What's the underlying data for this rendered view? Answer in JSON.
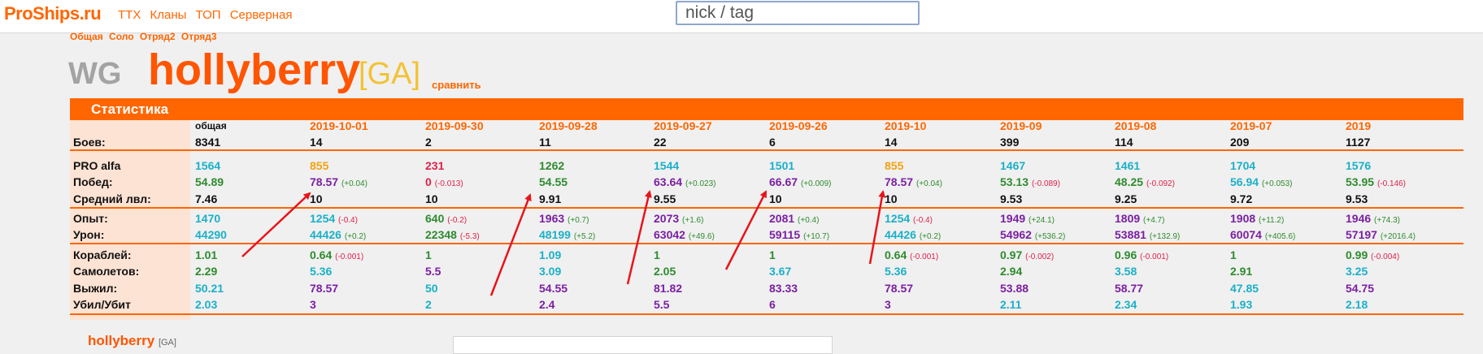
{
  "header": {
    "logo": "ProShips.ru",
    "nav": [
      "ТТХ",
      "Кланы",
      "ТОП",
      "Серверная"
    ],
    "search_placeholder": "nick / tag"
  },
  "view_tabs": [
    "Общая",
    "Соло",
    "Отряд2",
    "Отряд3"
  ],
  "player": {
    "clan_logo": "WG",
    "name": "hollyberry",
    "tag": "[GA]",
    "compare": "сравнить"
  },
  "stats": {
    "title": "Статистика",
    "columns": [
      "общая",
      "2019-10-01",
      "2019-09-30",
      "2019-09-28",
      "2019-09-27",
      "2019-09-26",
      "2019-10",
      "2019-09",
      "2019-08",
      "2019-07",
      "2019"
    ],
    "rows": [
      {
        "label": "Боев:",
        "cells": [
          {
            "v": "8341",
            "c": "#111111"
          },
          {
            "v": "14",
            "c": "#111111"
          },
          {
            "v": "2",
            "c": "#111111"
          },
          {
            "v": "11",
            "c": "#111111"
          },
          {
            "v": "22",
            "c": "#111111"
          },
          {
            "v": "6",
            "c": "#111111"
          },
          {
            "v": "14",
            "c": "#111111"
          },
          {
            "v": "399",
            "c": "#111111"
          },
          {
            "v": "114",
            "c": "#111111"
          },
          {
            "v": "209",
            "c": "#111111"
          },
          {
            "v": "1127",
            "c": "#111111"
          }
        ]
      },
      {
        "label": "PRO alfa",
        "cells": [
          {
            "v": "1564",
            "c": "#1ab0c8"
          },
          {
            "v": "855",
            "c": "#f2a20f"
          },
          {
            "v": "231",
            "c": "#e0204a"
          },
          {
            "v": "1262",
            "c": "#2e8b2e"
          },
          {
            "v": "1544",
            "c": "#1ab0c8"
          },
          {
            "v": "1501",
            "c": "#1ab0c8"
          },
          {
            "v": "855",
            "c": "#f2a20f"
          },
          {
            "v": "1467",
            "c": "#1ab0c8"
          },
          {
            "v": "1461",
            "c": "#1ab0c8"
          },
          {
            "v": "1704",
            "c": "#1ab0c8"
          },
          {
            "v": "1576",
            "c": "#1ab0c8"
          }
        ]
      },
      {
        "label": "Побед:",
        "cells": [
          {
            "v": "54.89",
            "c": "#2e8b2e"
          },
          {
            "v": "78.57",
            "c": "#7b1fa2",
            "d": "(+0.04)",
            "dc": "#2e8b2e"
          },
          {
            "v": "0",
            "c": "#e0204a",
            "d": "(-0.013)",
            "dc": "#e0204a"
          },
          {
            "v": "54.55",
            "c": "#2e8b2e"
          },
          {
            "v": "63.64",
            "c": "#7b1fa2",
            "d": "(+0.023)",
            "dc": "#2e8b2e"
          },
          {
            "v": "66.67",
            "c": "#7b1fa2",
            "d": "(+0.009)",
            "dc": "#2e8b2e"
          },
          {
            "v": "78.57",
            "c": "#7b1fa2",
            "d": "(+0.04)",
            "dc": "#2e8b2e"
          },
          {
            "v": "53.13",
            "c": "#2e8b2e",
            "d": "(-0.089)",
            "dc": "#e0204a"
          },
          {
            "v": "48.25",
            "c": "#2e8b2e",
            "d": "(-0.092)",
            "dc": "#e0204a"
          },
          {
            "v": "56.94",
            "c": "#1ab0c8",
            "d": "(+0.053)",
            "dc": "#2e8b2e"
          },
          {
            "v": "53.95",
            "c": "#2e8b2e",
            "d": "(-0.146)",
            "dc": "#e0204a"
          }
        ]
      },
      {
        "label": "Средний лвл:",
        "cells": [
          {
            "v": "7.46",
            "c": "#111111"
          },
          {
            "v": "10",
            "c": "#111111"
          },
          {
            "v": "10",
            "c": "#111111"
          },
          {
            "v": "9.91",
            "c": "#111111"
          },
          {
            "v": "9.55",
            "c": "#111111"
          },
          {
            "v": "10",
            "c": "#111111"
          },
          {
            "v": "10",
            "c": "#111111"
          },
          {
            "v": "9.53",
            "c": "#111111"
          },
          {
            "v": "9.25",
            "c": "#111111"
          },
          {
            "v": "9.72",
            "c": "#111111"
          },
          {
            "v": "9.53",
            "c": "#111111"
          }
        ]
      },
      {
        "label": "Опыт:",
        "cells": [
          {
            "v": "1470",
            "c": "#1ab0c8"
          },
          {
            "v": "1254",
            "c": "#1ab0c8",
            "d": "(-0.4)",
            "dc": "#e0204a"
          },
          {
            "v": "640",
            "c": "#2e8b2e",
            "d": "(-0.2)",
            "dc": "#e0204a"
          },
          {
            "v": "1963",
            "c": "#7b1fa2",
            "d": "(+0.7)",
            "dc": "#2e8b2e"
          },
          {
            "v": "2073",
            "c": "#7b1fa2",
            "d": "(+1.6)",
            "dc": "#2e8b2e"
          },
          {
            "v": "2081",
            "c": "#7b1fa2",
            "d": "(+0.4)",
            "dc": "#2e8b2e"
          },
          {
            "v": "1254",
            "c": "#1ab0c8",
            "d": "(-0.4)",
            "dc": "#e0204a"
          },
          {
            "v": "1949",
            "c": "#7b1fa2",
            "d": "(+24.1)",
            "dc": "#2e8b2e"
          },
          {
            "v": "1809",
            "c": "#7b1fa2",
            "d": "(+4.7)",
            "dc": "#2e8b2e"
          },
          {
            "v": "1908",
            "c": "#7b1fa2",
            "d": "(+11.2)",
            "dc": "#2e8b2e"
          },
          {
            "v": "1946",
            "c": "#7b1fa2",
            "d": "(+74.3)",
            "dc": "#2e8b2e"
          }
        ]
      },
      {
        "label": "Урон:",
        "cells": [
          {
            "v": "44290",
            "c": "#1ab0c8"
          },
          {
            "v": "44426",
            "c": "#1ab0c8",
            "d": "(+0.2)",
            "dc": "#2e8b2e"
          },
          {
            "v": "22348",
            "c": "#2e8b2e",
            "d": "(-5.3)",
            "dc": "#e0204a"
          },
          {
            "v": "48199",
            "c": "#1ab0c8",
            "d": "(+5.2)",
            "dc": "#2e8b2e"
          },
          {
            "v": "63042",
            "c": "#7b1fa2",
            "d": "(+49.6)",
            "dc": "#2e8b2e"
          },
          {
            "v": "59115",
            "c": "#7b1fa2",
            "d": "(+10.7)",
            "dc": "#2e8b2e"
          },
          {
            "v": "44426",
            "c": "#1ab0c8",
            "d": "(+0.2)",
            "dc": "#2e8b2e"
          },
          {
            "v": "54962",
            "c": "#7b1fa2",
            "d": "(+536.2)",
            "dc": "#2e8b2e"
          },
          {
            "v": "53881",
            "c": "#7b1fa2",
            "d": "(+132.9)",
            "dc": "#2e8b2e"
          },
          {
            "v": "60074",
            "c": "#7b1fa2",
            "d": "(+405.6)",
            "dc": "#2e8b2e"
          },
          {
            "v": "57197",
            "c": "#7b1fa2",
            "d": "(+2016.4)",
            "dc": "#2e8b2e"
          }
        ]
      },
      {
        "label": "Кораблей:",
        "cells": [
          {
            "v": "1.01",
            "c": "#2e8b2e"
          },
          {
            "v": "0.64",
            "c": "#2e8b2e",
            "d": "(-0.001)",
            "dc": "#e0204a"
          },
          {
            "v": "1",
            "c": "#2e8b2e"
          },
          {
            "v": "1.09",
            "c": "#1ab0c8"
          },
          {
            "v": "1",
            "c": "#2e8b2e"
          },
          {
            "v": "1",
            "c": "#2e8b2e"
          },
          {
            "v": "0.64",
            "c": "#2e8b2e",
            "d": "(-0.001)",
            "dc": "#e0204a"
          },
          {
            "v": "0.97",
            "c": "#2e8b2e",
            "d": "(-0.002)",
            "dc": "#e0204a"
          },
          {
            "v": "0.96",
            "c": "#2e8b2e",
            "d": "(-0.001)",
            "dc": "#e0204a"
          },
          {
            "v": "1",
            "c": "#2e8b2e"
          },
          {
            "v": "0.99",
            "c": "#2e8b2e",
            "d": "(-0.004)",
            "dc": "#e0204a"
          }
        ]
      },
      {
        "label": "Самолетов:",
        "cells": [
          {
            "v": "2.29",
            "c": "#2e8b2e"
          },
          {
            "v": "5.36",
            "c": "#1ab0c8"
          },
          {
            "v": "5.5",
            "c": "#7b1fa2"
          },
          {
            "v": "3.09",
            "c": "#1ab0c8"
          },
          {
            "v": "2.05",
            "c": "#2e8b2e"
          },
          {
            "v": "3.67",
            "c": "#1ab0c8"
          },
          {
            "v": "5.36",
            "c": "#1ab0c8"
          },
          {
            "v": "2.94",
            "c": "#2e8b2e"
          },
          {
            "v": "3.58",
            "c": "#1ab0c8"
          },
          {
            "v": "2.91",
            "c": "#2e8b2e"
          },
          {
            "v": "3.25",
            "c": "#1ab0c8"
          }
        ]
      },
      {
        "label": "Выжил:",
        "cells": [
          {
            "v": "50.21",
            "c": "#1ab0c8"
          },
          {
            "v": "78.57",
            "c": "#7b1fa2"
          },
          {
            "v": "50",
            "c": "#1ab0c8"
          },
          {
            "v": "54.55",
            "c": "#7b1fa2"
          },
          {
            "v": "81.82",
            "c": "#7b1fa2"
          },
          {
            "v": "83.33",
            "c": "#7b1fa2"
          },
          {
            "v": "78.57",
            "c": "#7b1fa2"
          },
          {
            "v": "53.88",
            "c": "#7b1fa2"
          },
          {
            "v": "58.77",
            "c": "#7b1fa2"
          },
          {
            "v": "47.85",
            "c": "#1ab0c8"
          },
          {
            "v": "54.75",
            "c": "#7b1fa2"
          }
        ]
      },
      {
        "label": "Убил/Убит",
        "cells": [
          {
            "v": "2.03",
            "c": "#1ab0c8"
          },
          {
            "v": "3",
            "c": "#7b1fa2"
          },
          {
            "v": "2",
            "c": "#1ab0c8"
          },
          {
            "v": "2.4",
            "c": "#7b1fa2"
          },
          {
            "v": "5.5",
            "c": "#7b1fa2"
          },
          {
            "v": "6",
            "c": "#7b1fa2"
          },
          {
            "v": "3",
            "c": "#7b1fa2"
          },
          {
            "v": "2.11",
            "c": "#1ab0c8"
          },
          {
            "v": "2.34",
            "c": "#1ab0c8"
          },
          {
            "v": "1.93",
            "c": "#1ab0c8"
          },
          {
            "v": "2.18",
            "c": "#1ab0c8"
          }
        ]
      }
    ]
  },
  "bottom": {
    "player_name": "hollyberry",
    "tag": "[GA]"
  },
  "colors": {
    "accent": "#ff6600",
    "player_name": "#ff5500",
    "clan_tag": "#f2c232",
    "label_column": "#fde3d4",
    "annotation_arrows": "#e8141a"
  }
}
